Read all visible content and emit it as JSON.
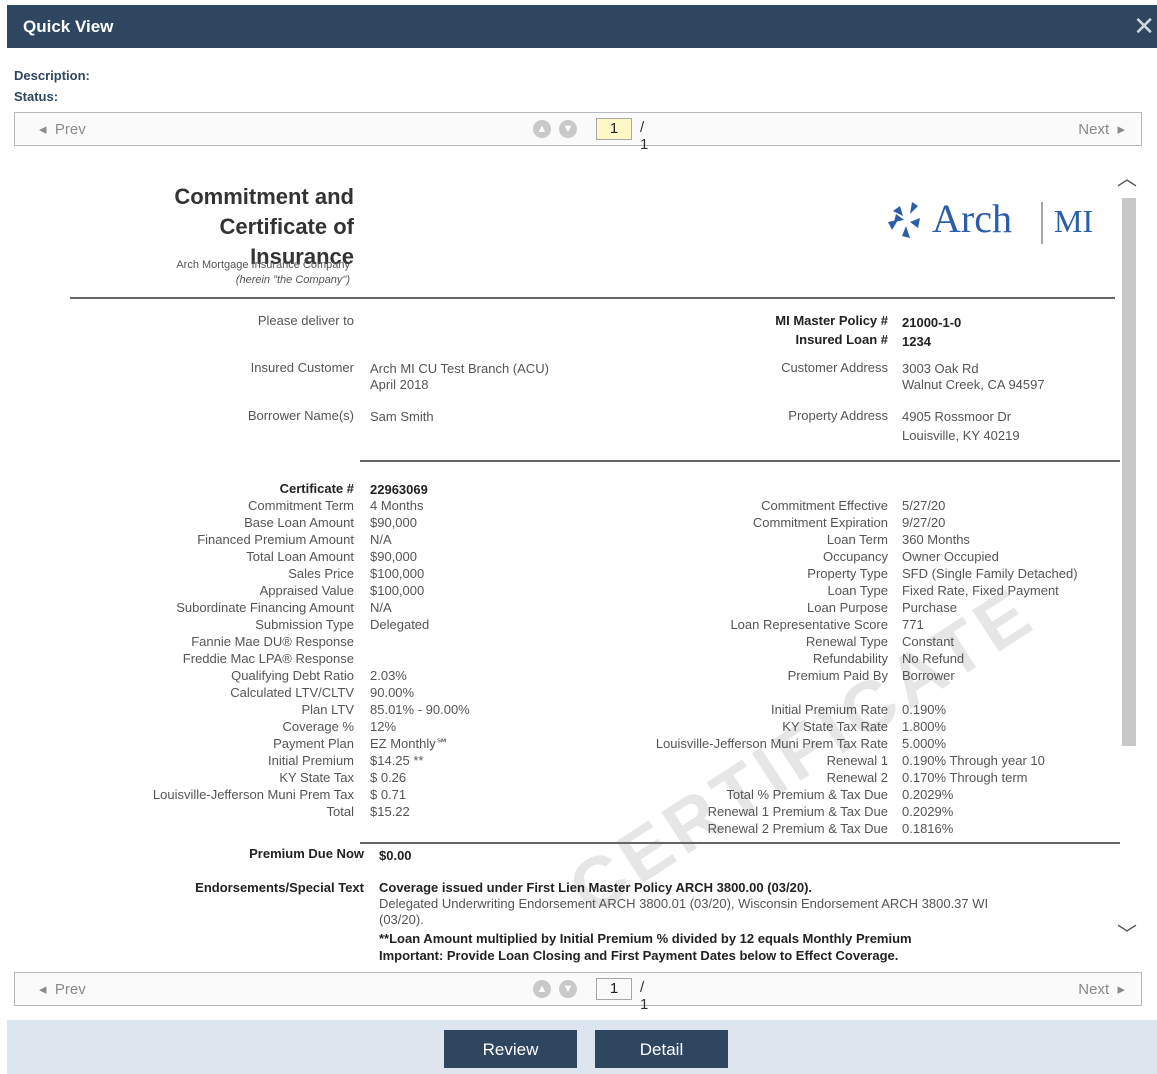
{
  "window": {
    "title": "Quick View",
    "close_symbol": "✕"
  },
  "meta": {
    "description_label": "Description:",
    "status_label": "Status:"
  },
  "pager": {
    "prev": "Prev",
    "next": "Next",
    "page": "1",
    "total": "/ 1"
  },
  "doc": {
    "title_line1": "Commitment and",
    "title_line2": "Certificate of Insurance",
    "company": "Arch Mortgage Insurance Company",
    "company_note": "(herein \"the Company\")",
    "logo_name": "Arch",
    "logo_suffix": "MI",
    "deliver_label": "Please deliver to",
    "master_policy_label": "MI Master Policy #",
    "master_policy_value": "21000-1-0",
    "insured_loan_label": "Insured Loan #",
    "insured_loan_value": "1234",
    "insured_customer_label": "Insured Customer",
    "insured_customer_value1": "Arch MI CU Test Branch (ACU)",
    "insured_customer_value2": "April 2018",
    "customer_address_label": "Customer Address",
    "customer_address1": "3003 Oak Rd",
    "customer_address2": "Walnut Creek, CA 94597",
    "borrower_label": "Borrower Name(s)",
    "borrower_value": "Sam Smith",
    "property_address_label": "Property Address",
    "property_address1": "4905 Rossmoor Dr",
    "property_address2": "Louisville, KY 40219",
    "certificate_label": "Certificate #",
    "certificate_value": "22963069",
    "left_rows": [
      {
        "label": "Commitment Term",
        "value": "4 Months"
      },
      {
        "label": "Base Loan Amount",
        "value": "$90,000"
      },
      {
        "label": "Financed Premium Amount",
        "value": "N/A"
      },
      {
        "label": "Total Loan Amount",
        "value": "$90,000"
      },
      {
        "label": "Sales Price",
        "value": "$100,000"
      },
      {
        "label": "Appraised Value",
        "value": "$100,000"
      },
      {
        "label": "Subordinate Financing Amount",
        "value": "N/A"
      },
      {
        "label": "Submission Type",
        "value": "Delegated"
      },
      {
        "label": "Fannie Mae DU® Response",
        "value": ""
      },
      {
        "label": "Freddie Mac LPA® Response",
        "value": ""
      },
      {
        "label": "Qualifying Debt Ratio",
        "value": "2.03%"
      },
      {
        "label": "Calculated LTV/CLTV",
        "value": "90.00%"
      },
      {
        "label": "Plan LTV",
        "value": "85.01% - 90.00%"
      },
      {
        "label": "Coverage %",
        "value": "12%"
      },
      {
        "label": "Payment Plan",
        "value": "EZ Monthly℠"
      },
      {
        "label": "Initial Premium",
        "value": "$14.25 **"
      },
      {
        "label": "KY State Tax",
        "value": "$  0.26"
      },
      {
        "label": "Louisville-Jefferson Muni Prem Tax",
        "value": "$  0.71"
      },
      {
        "label": "Total",
        "value": "$15.22"
      }
    ],
    "right_rows": [
      {
        "label": "Commitment Effective",
        "value": "5/27/20"
      },
      {
        "label": "Commitment Expiration",
        "value": "9/27/20"
      },
      {
        "label": "Loan Term",
        "value": "360 Months"
      },
      {
        "label": "Occupancy",
        "value": "Owner Occupied"
      },
      {
        "label": "Property Type",
        "value": "SFD (Single Family Detached)"
      },
      {
        "label": "Loan Type",
        "value": "Fixed Rate, Fixed Payment"
      },
      {
        "label": "Loan Purpose",
        "value": "Purchase"
      },
      {
        "label": "Loan Representative Score",
        "value": "771"
      },
      {
        "label": "Renewal Type",
        "value": "Constant"
      },
      {
        "label": "Refundability",
        "value": "No Refund"
      },
      {
        "label": "Premium Paid By",
        "value": "Borrower"
      },
      {
        "label": "",
        "value": ""
      },
      {
        "label": "Initial Premium Rate",
        "value": "0.190%"
      },
      {
        "label": "KY State Tax Rate",
        "value": "1.800%"
      },
      {
        "label": "Louisville-Jefferson Muni Prem Tax Rate",
        "value": "5.000%"
      },
      {
        "label": "Renewal 1",
        "value": "0.190% Through year 10"
      },
      {
        "label": "Renewal 2",
        "value": "0.170% Through term"
      },
      {
        "label": "Total % Premium & Tax Due",
        "value": "0.2029%"
      },
      {
        "label": "Renewal 1 Premium & Tax Due",
        "value": "0.2029%"
      },
      {
        "label": "Renewal 2 Premium & Tax Due",
        "value": "0.1816%"
      }
    ],
    "premium_due_label": "Premium Due Now",
    "premium_due_value": "$0.00",
    "endorsements_label": "Endorsements/Special Text",
    "endorse_line1": "Coverage issued under First Lien Master Policy ARCH 3800.00 (03/20).",
    "endorse_line2": "Delegated Underwriting Endorsement ARCH 3800.01 (03/20), Wisconsin Endorsement ARCH 3800.37 WI",
    "endorse_line3": "(03/20).",
    "endorse_line4": "**Loan Amount multiplied by Initial Premium % divided by 12 equals Monthly Premium",
    "endorse_line5": "Important: Provide Loan Closing and First Payment Dates below to Effect Coverage.",
    "watermark": "CERTIFICATE"
  },
  "footer": {
    "review": "Review",
    "detail": "Detail"
  }
}
